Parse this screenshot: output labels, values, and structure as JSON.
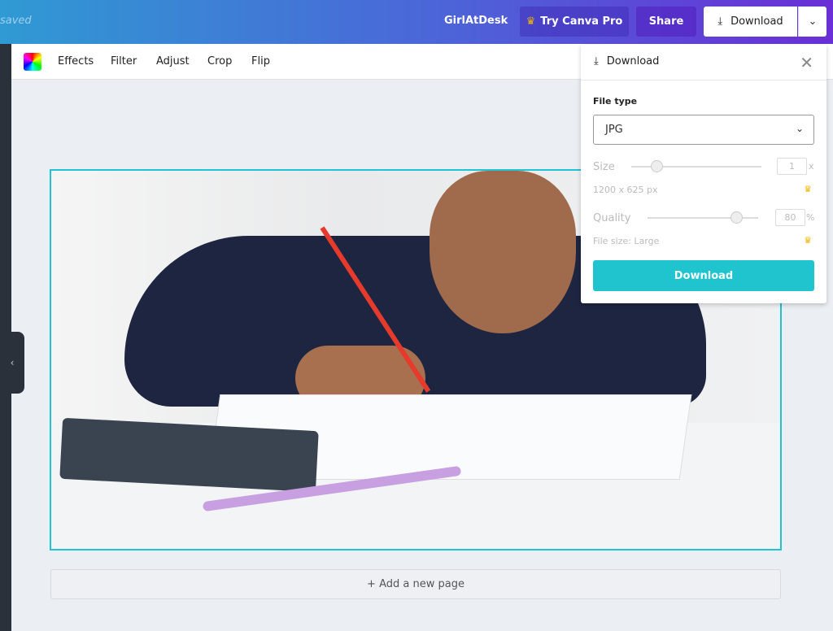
{
  "topbar": {
    "status": "saved",
    "design_name": "GirlAtDesk",
    "try_pro": "Try Canva Pro",
    "share": "Share",
    "download": "Download"
  },
  "toolbar": {
    "items": [
      "Effects",
      "Filter",
      "Adjust",
      "Crop",
      "Flip"
    ]
  },
  "canvas": {
    "add_page": "+ Add a new page"
  },
  "download_panel": {
    "title": "Download",
    "file_type_label": "File type",
    "file_type": "JPG",
    "size_label": "Size",
    "size_value": "1",
    "size_unit": "x",
    "dimensions": "1200 x 625 px",
    "quality_label": "Quality",
    "quality_value": "80",
    "quality_unit": "%",
    "file_size": "File size: Large",
    "download_button": "Download",
    "size_slider_fraction": 0.2,
    "quality_slider_fraction": 0.8
  },
  "colors": {
    "accent": "#1fc4cf",
    "pro_crown": "#f0b400",
    "selection": "#1fc3d2"
  }
}
